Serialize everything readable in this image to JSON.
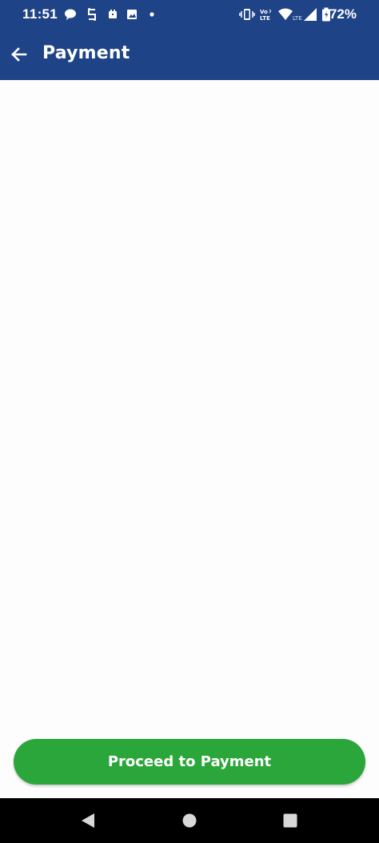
{
  "status_bar": {
    "time": "11:51",
    "battery_percent": "72%",
    "left_icons": [
      "chat-bubble-icon",
      "s-app-icon",
      "calendar-icon",
      "image-icon",
      "dot-icon"
    ],
    "right_icons": [
      "vibrate-icon",
      "volte-icon",
      "wifi-icon",
      "lte-signal-icon",
      "battery-icon"
    ],
    "volte_label": "Vo LTE",
    "lte_label": "LTE"
  },
  "app_bar": {
    "title": "Payment",
    "back_icon": "arrow-left-icon",
    "color": "#1e4386"
  },
  "footer": {
    "proceed_label": "Proceed to Payment",
    "button_color": "#2ba63a"
  },
  "nav_bar": {
    "buttons": [
      "back-triangle-icon",
      "home-circle-icon",
      "recents-square-icon"
    ]
  }
}
